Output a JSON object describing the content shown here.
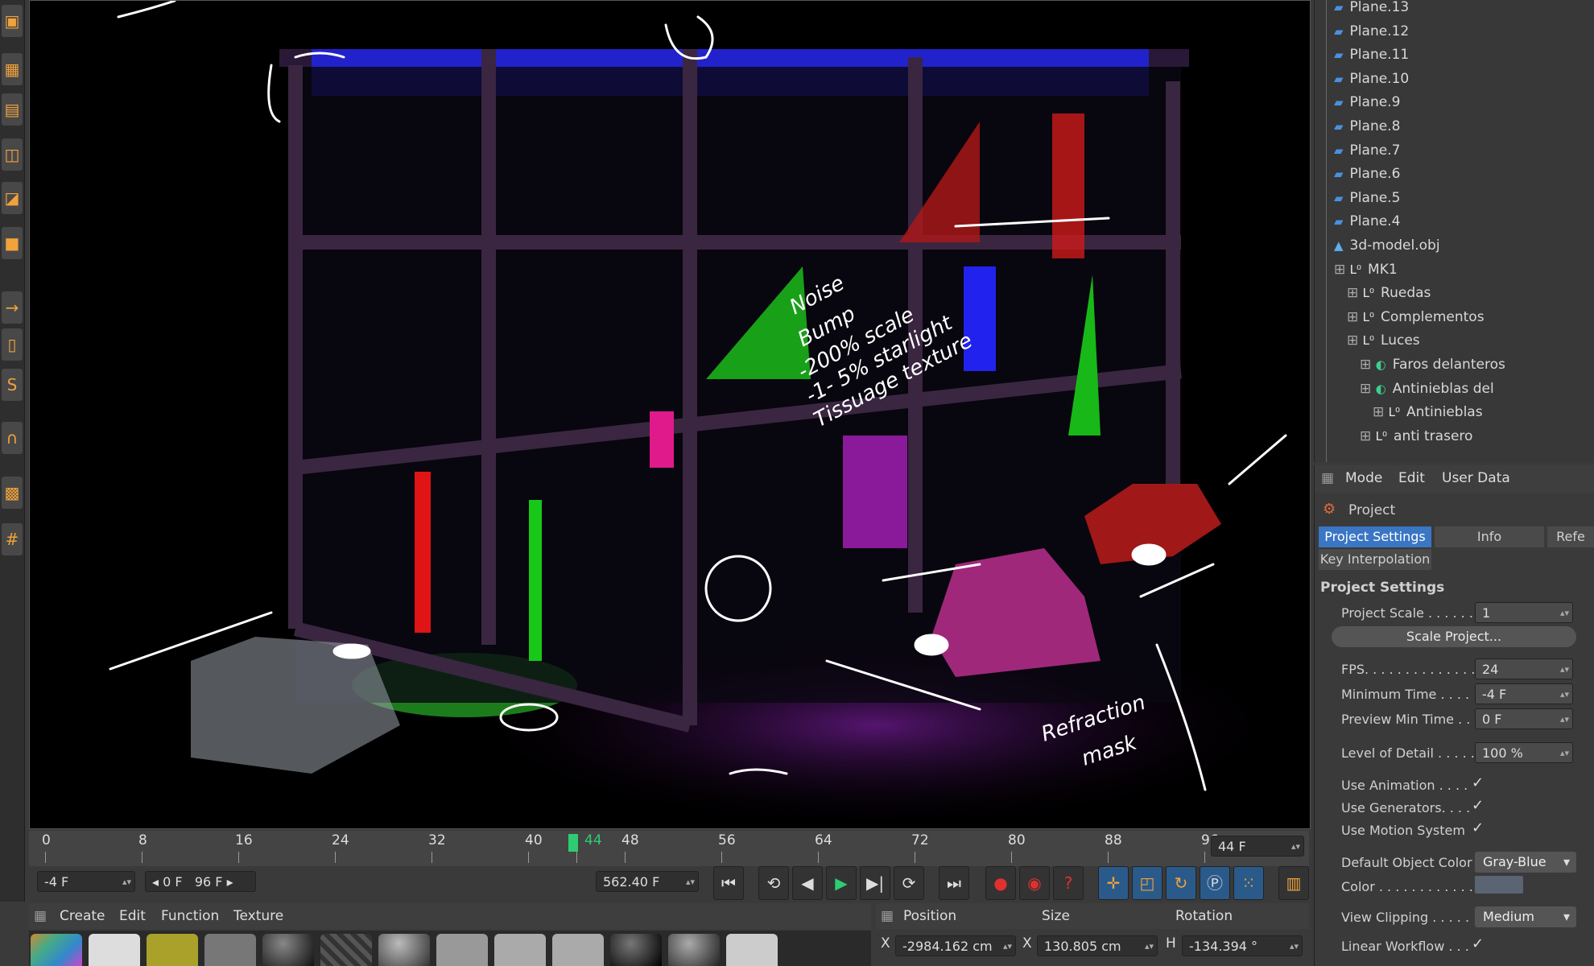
{
  "left_toolbar": {
    "icons": [
      "cube-icon",
      "checker-icon",
      "plane-grid-icon",
      "cube-outline-icon",
      "box-icon",
      "orange-cube-icon",
      "arrow-icon",
      "mouse-icon",
      "s-icon",
      "magnet-icon",
      "lock-grid-icon",
      "grid-icon"
    ]
  },
  "viewport": {
    "annotations": {
      "noise_note": [
        "Noise",
        "Bump",
        "-200% scale",
        "-1- 5% starlight",
        "Tissuage texture"
      ],
      "refraction_note": [
        "Refraction",
        "mask"
      ]
    }
  },
  "timeline": {
    "ticks": [
      "0",
      "8",
      "16",
      "24",
      "32",
      "40",
      "44",
      "48",
      "56",
      "64",
      "72",
      "80",
      "88",
      "96"
    ],
    "current_frame_marker": "44",
    "current_frame_field": "44 F",
    "min_field": "-4 F",
    "range_start": "0 F",
    "range_end": "96 F",
    "time_field": "562.40 F"
  },
  "material_manager": {
    "menu": [
      "Create",
      "Edit",
      "Function",
      "Texture"
    ]
  },
  "coordinates": {
    "headers": [
      "Position",
      "Size",
      "Rotation"
    ],
    "x_label": "X",
    "x_position": "-2984.162 cm",
    "x_size_label": "X",
    "x_size": "130.805 cm",
    "h_label": "H",
    "h_rotation": "-134.394 °"
  },
  "object_manager": {
    "items": [
      {
        "label": "Plane.13",
        "indent": 0,
        "icon": "plane-icon"
      },
      {
        "label": "Plane.12",
        "indent": 0,
        "icon": "plane-icon"
      },
      {
        "label": "Plane.11",
        "indent": 0,
        "icon": "plane-icon"
      },
      {
        "label": "Plane.10",
        "indent": 0,
        "icon": "plane-icon"
      },
      {
        "label": "Plane.9",
        "indent": 0,
        "icon": "plane-icon"
      },
      {
        "label": "Plane.8",
        "indent": 0,
        "icon": "plane-icon"
      },
      {
        "label": "Plane.7",
        "indent": 0,
        "icon": "plane-icon"
      },
      {
        "label": "Plane.6",
        "indent": 0,
        "icon": "plane-icon"
      },
      {
        "label": "Plane.5",
        "indent": 0,
        "icon": "plane-icon"
      },
      {
        "label": "Plane.4",
        "indent": 0,
        "icon": "plane-icon"
      },
      {
        "label": "3d-model.obj",
        "indent": 0,
        "icon": "polygon-object-icon"
      },
      {
        "label": "MK1",
        "indent": 0,
        "icon": "null-object-icon"
      },
      {
        "label": "Ruedas",
        "indent": 1,
        "icon": "null-object-icon"
      },
      {
        "label": "Complementos",
        "indent": 1,
        "icon": "null-object-icon"
      },
      {
        "label": "Luces",
        "indent": 1,
        "icon": "null-object-icon"
      },
      {
        "label": "Faros delanteros",
        "indent": 2,
        "icon": "light-icon"
      },
      {
        "label": "Antinieblas del",
        "indent": 2,
        "icon": "light-icon"
      },
      {
        "label": "Antinieblas",
        "indent": 3,
        "icon": "null-object-icon"
      },
      {
        "label": "anti trasero",
        "indent": 2,
        "icon": "null-object-icon"
      }
    ]
  },
  "attribute_manager": {
    "menu": [
      "Mode",
      "Edit",
      "User Data"
    ],
    "object_title": "Project",
    "tabs": [
      "Project Settings",
      "Info",
      "Refe"
    ],
    "subtab": "Key Interpolation",
    "section_title": "Project Settings",
    "fields": {
      "project_scale_label": "Project Scale . . . . . .",
      "project_scale_value": "1",
      "scale_button": "Scale Project...",
      "fps_label": "FPS. . . . . . . . . . . . . .",
      "fps_value": "24",
      "min_time_label": "Minimum Time . . . .",
      "min_time_value": "-4 F",
      "preview_min_label": "Preview Min Time . .",
      "preview_min_value": "0 F",
      "lod_label": "Level of Detail . . . . .",
      "lod_value": "100 %",
      "use_animation_label": "Use Animation . . . .",
      "use_generators_label": "Use Generators. . . .",
      "use_motion_label": "Use Motion System",
      "default_color_label": "Default Object Color",
      "default_color_value": "Gray-Blue",
      "color_label": "Color . . . . . . . . . . . .",
      "view_clipping_label": "View Clipping . . . . .",
      "view_clipping_value": "Medium",
      "linear_workflow_label": "Linear Workflow . . .",
      "check_mark": "✓"
    }
  }
}
